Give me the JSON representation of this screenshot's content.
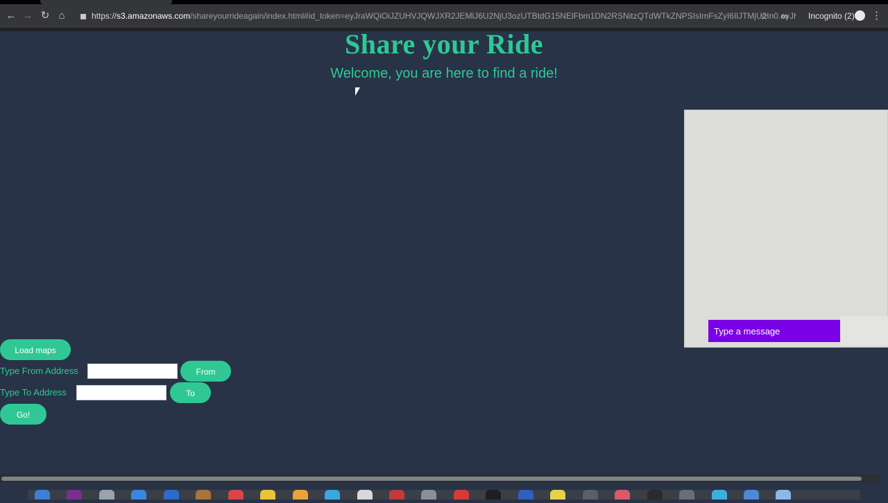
{
  "browser": {
    "url_prefix": "https://",
    "url_host": "s3.amazonaws.com",
    "url_path": "/shareyourrideagain/index.html#id_token=eyJraWQiOiJZUHVJQWJXR2JEMlJ6U2NjU3ozUTBtdG15NElFbm1DN2RSNitzQTdWTkZNPSIsImFsZyI6IlJTMjU2In0.eyJh...",
    "profile_label": "Incognito (2)"
  },
  "page": {
    "title": "Share your Ride",
    "subtitle": "Welcome, you are here to find a ride!"
  },
  "chat": {
    "input_placeholder": "Type a message"
  },
  "controls": {
    "load_maps_label": "Load maps",
    "from_address_label": "Type From Address",
    "from_button_label": "From",
    "to_address_label": "Type To Address",
    "to_button_label": "To",
    "go_button_label": "Go!"
  },
  "colors": {
    "background": "#283347",
    "accent": "#2fc895",
    "chat_input": "#7a00e6"
  }
}
